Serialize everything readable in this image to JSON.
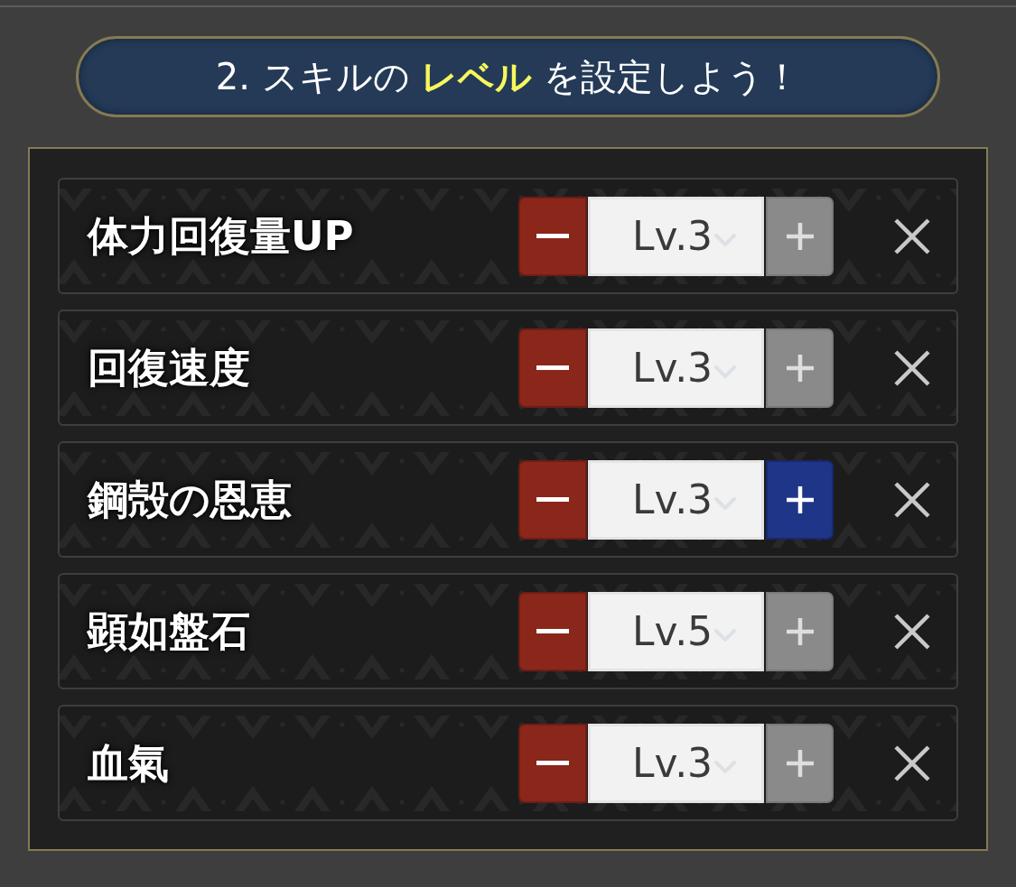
{
  "header": {
    "title": "2. スキルの **レベル** を設定しよう！"
  },
  "skills": [
    {
      "name": "体力回復量UP",
      "level": "Lv.3",
      "plus_enabled": false
    },
    {
      "name": "回復速度",
      "level": "Lv.3",
      "plus_enabled": false
    },
    {
      "name": "鋼殻の恩恵",
      "level": "Lv.3",
      "plus_enabled": true
    },
    {
      "name": "顕如盤石",
      "level": "Lv.5",
      "plus_enabled": false
    },
    {
      "name": "血氣",
      "level": "Lv.3",
      "plus_enabled": false
    }
  ]
}
